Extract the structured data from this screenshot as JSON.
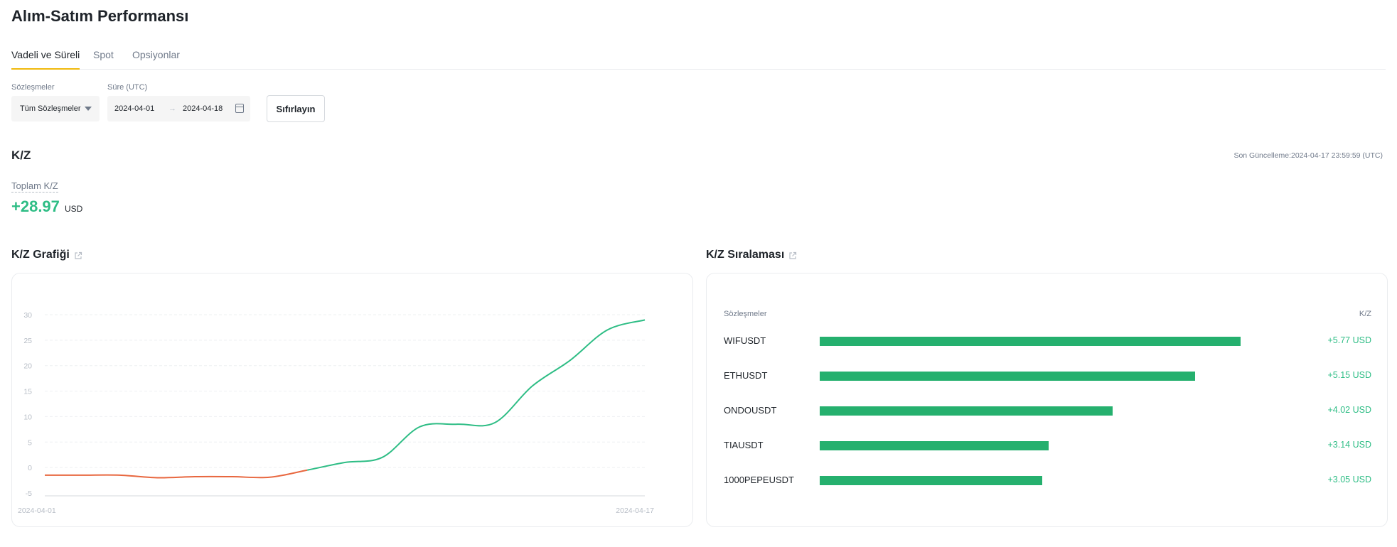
{
  "page_title": "Alım-Satım Performansı",
  "tabs": [
    {
      "label": "Vadeli ve Süreli",
      "active": true
    },
    {
      "label": "Spot",
      "active": false
    },
    {
      "label": "Opsiyonlar",
      "active": false
    }
  ],
  "filters": {
    "contracts_label": "Sözleşmeler",
    "contracts_value": "Tüm Sözleşmeler",
    "duration_label": "Süre (UTC)",
    "start_date": "2024-04-01",
    "arrow": "→",
    "end_date": "2024-04-18",
    "reset_label": "Sıfırlayın"
  },
  "pnl": {
    "title": "K/Z",
    "last_update": "Son Güncelleme:2024-04-17 23:59:59 (UTC)",
    "total_label": "Toplam K/Z",
    "total_value": "+28.97",
    "total_unit": "USD"
  },
  "pnl_chart_title": "K/Z Grafiği",
  "ranking_title": "K/Z Sıralaması",
  "ranking": {
    "col_contract": "Sözleşmeler",
    "col_pnl": "K/Z",
    "rows": [
      {
        "name": "WIFUSDT",
        "value": 5.77,
        "label": "+5.77 USD"
      },
      {
        "name": "ETHUSDT",
        "value": 5.15,
        "label": "+5.15 USD"
      },
      {
        "name": "ONDOUSDT",
        "value": 4.02,
        "label": "+4.02 USD"
      },
      {
        "name": "TIAUSDT",
        "value": 3.14,
        "label": "+3.14 USD"
      },
      {
        "name": "1000PEPEUSDT",
        "value": 3.05,
        "label": "+3.05 USD"
      }
    ]
  },
  "colors": {
    "positive": "#2ebd85",
    "negative": "#e8673f",
    "bar": "#25b06e",
    "accent": "#f0b90b"
  },
  "chart_data": {
    "type": "line",
    "x_labels": [
      "2024-04-01",
      "2024-04-17"
    ],
    "x": [
      "2024-04-01",
      "2024-04-02",
      "2024-04-03",
      "2024-04-04",
      "2024-04-05",
      "2024-04-06",
      "2024-04-07",
      "2024-04-08",
      "2024-04-09",
      "2024-04-10",
      "2024-04-11",
      "2024-04-12",
      "2024-04-13",
      "2024-04-14",
      "2024-04-15",
      "2024-04-16",
      "2024-04-17"
    ],
    "y": [
      -1.5,
      -1.5,
      -1.5,
      -2.0,
      -1.8,
      -1.8,
      -1.9,
      -0.5,
      1.0,
      2.0,
      8.0,
      8.5,
      8.8,
      16.0,
      21.0,
      27.0,
      28.97
    ],
    "yticks": [
      30,
      25,
      20,
      15,
      10,
      5,
      0,
      -5
    ],
    "ylim": [
      -5,
      30
    ],
    "grid": true,
    "line_color_positive": "#2ebd85",
    "line_color_negative": "#e8673f"
  }
}
